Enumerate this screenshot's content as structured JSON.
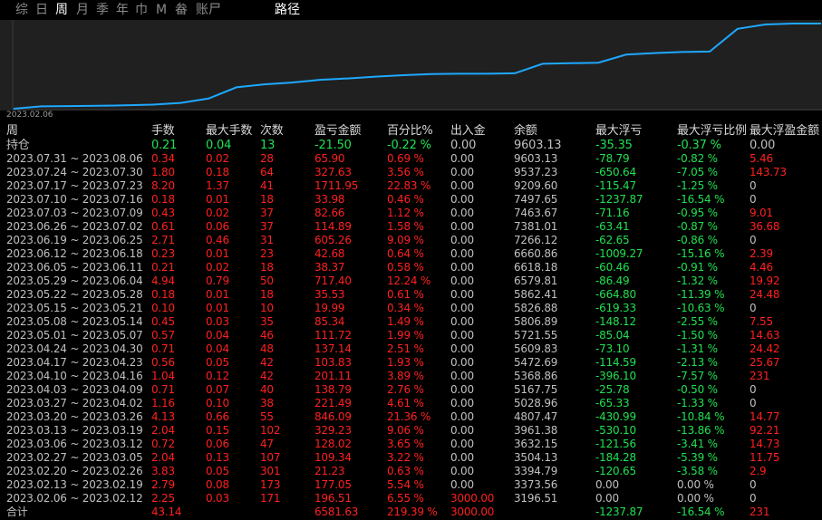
{
  "tabs": [
    {
      "label": "综",
      "active": false
    },
    {
      "label": "日",
      "active": false
    },
    {
      "label": "周",
      "active": true
    },
    {
      "label": "月",
      "active": false
    },
    {
      "label": "季",
      "active": false
    },
    {
      "label": "年",
      "active": false
    },
    {
      "label": "巾",
      "active": false
    },
    {
      "label": "M",
      "active": false
    },
    {
      "label": "畚",
      "active": false
    },
    {
      "label": "账尸",
      "active": false
    }
  ],
  "path_label": "路径",
  "chart_data": {
    "type": "line",
    "title": "",
    "x_tick_labels": [
      "2023.02.06"
    ],
    "series": [
      {
        "values": [
          3196.51,
          3373.56,
          3394.79,
          3413.0,
          3450.0,
          3504.13,
          3632.15,
          3961.38,
          4807.47,
          5028.96,
          5167.75,
          5368.86,
          5472.69,
          5609.83,
          5721.55,
          5806.89,
          5826.88,
          5826.88,
          5862.41,
          6579.81,
          6618.18,
          6660.86,
          7266.12,
          7381.01,
          7463.67,
          7497.65,
          9209.6,
          9537.23,
          9603.13,
          9603.13
        ]
      }
    ],
    "grid": false,
    "line_color": "#1ea8ff"
  },
  "table": {
    "period_header": "周",
    "headers": [
      "手数",
      "最大手数",
      "次数",
      "盈亏金额",
      "百分比%",
      "出入金",
      "余额",
      "最大浮亏",
      "最大浮亏比例",
      "最大浮盈金额"
    ],
    "holding": {
      "label": "持仓",
      "values": [
        "0.21",
        "0.04",
        "13",
        "-21.50",
        "-0.22 %",
        "0.00",
        "9603.13",
        "-35.35",
        "-0.37 %",
        "0.00"
      ]
    },
    "rows": [
      {
        "period": "2023.07.31 ~ 2023.08.06",
        "values": [
          "0.34",
          "0.02",
          "28",
          "65.90",
          "0.69 %",
          "0.00",
          "9603.13",
          "-78.79",
          "-0.82 %",
          "5.46"
        ]
      },
      {
        "period": "2023.07.24 ~ 2023.07.30",
        "values": [
          "1.80",
          "0.18",
          "64",
          "327.63",
          "3.56 %",
          "0.00",
          "9537.23",
          "-650.64",
          "-7.05 %",
          "143.73"
        ]
      },
      {
        "period": "2023.07.17 ~ 2023.07.23",
        "values": [
          "8.20",
          "1.37",
          "41",
          "1711.95",
          "22.83 %",
          "0.00",
          "9209.60",
          "-115.47",
          "-1.25 %",
          "0"
        ]
      },
      {
        "period": "2023.07.10 ~ 2023.07.16",
        "values": [
          "0.18",
          "0.01",
          "18",
          "33.98",
          "0.46 %",
          "0.00",
          "7497.65",
          "-1237.87",
          "-16.54 %",
          "0"
        ]
      },
      {
        "period": "2023.07.03 ~ 2023.07.09",
        "values": [
          "0.43",
          "0.02",
          "37",
          "82.66",
          "1.12 %",
          "0.00",
          "7463.67",
          "-71.16",
          "-0.95 %",
          "9.01"
        ]
      },
      {
        "period": "2023.06.26 ~ 2023.07.02",
        "values": [
          "0.61",
          "0.06",
          "37",
          "114.89",
          "1.58 %",
          "0.00",
          "7381.01",
          "-63.41",
          "-0.87 %",
          "36.68"
        ]
      },
      {
        "period": "2023.06.19 ~ 2023.06.25",
        "values": [
          "2.71",
          "0.46",
          "31",
          "605.26",
          "9.09 %",
          "0.00",
          "7266.12",
          "-62.65",
          "-0.86 %",
          "0"
        ]
      },
      {
        "period": "2023.06.12 ~ 2023.06.18",
        "values": [
          "0.23",
          "0.01",
          "23",
          "42.68",
          "0.64 %",
          "0.00",
          "6660.86",
          "-1009.27",
          "-15.16 %",
          "2.39"
        ]
      },
      {
        "period": "2023.06.05 ~ 2023.06.11",
        "values": [
          "0.21",
          "0.02",
          "18",
          "38.37",
          "0.58 %",
          "0.00",
          "6618.18",
          "-60.46",
          "-0.91 %",
          "4.46"
        ]
      },
      {
        "period": "2023.05.29 ~ 2023.06.04",
        "values": [
          "4.94",
          "0.79",
          "50",
          "717.40",
          "12.24 %",
          "0.00",
          "6579.81",
          "-86.49",
          "-1.32 %",
          "19.92"
        ]
      },
      {
        "period": "2023.05.22 ~ 2023.05.28",
        "values": [
          "0.18",
          "0.01",
          "18",
          "35.53",
          "0.61 %",
          "0.00",
          "5862.41",
          "-664.80",
          "-11.39 %",
          "24.48"
        ]
      },
      {
        "period": "2023.05.15 ~ 2023.05.21",
        "values": [
          "0.10",
          "0.01",
          "10",
          "19.99",
          "0.34 %",
          "0.00",
          "5826.88",
          "-619.33",
          "-10.63 %",
          "0"
        ]
      },
      {
        "period": "2023.05.08 ~ 2023.05.14",
        "values": [
          "0.45",
          "0.03",
          "35",
          "85.34",
          "1.49 %",
          "0.00",
          "5806.89",
          "-148.12",
          "-2.55 %",
          "7.55"
        ]
      },
      {
        "period": "2023.05.01 ~ 2023.05.07",
        "values": [
          "0.57",
          "0.04",
          "46",
          "111.72",
          "1.99 %",
          "0.00",
          "5721.55",
          "-85.04",
          "-1.50 %",
          "14.63"
        ]
      },
      {
        "period": "2023.04.24 ~ 2023.04.30",
        "values": [
          "0.71",
          "0.04",
          "48",
          "137.14",
          "2.51 %",
          "0.00",
          "5609.83",
          "-73.10",
          "-1.31 %",
          "24.42"
        ]
      },
      {
        "period": "2023.04.17 ~ 2023.04.23",
        "values": [
          "0.56",
          "0.05",
          "42",
          "103.83",
          "1.93 %",
          "0.00",
          "5472.69",
          "-114.59",
          "-2.13 %",
          "25.67"
        ]
      },
      {
        "period": "2023.04.10 ~ 2023.04.16",
        "values": [
          "1.04",
          "0.12",
          "42",
          "201.11",
          "3.89 %",
          "0.00",
          "5368.86",
          "-396.10",
          "-7.57 %",
          "231"
        ]
      },
      {
        "period": "2023.04.03 ~ 2023.04.09",
        "values": [
          "0.71",
          "0.07",
          "40",
          "138.79",
          "2.76 %",
          "0.00",
          "5167.75",
          "-25.78",
          "-0.50 %",
          "0"
        ]
      },
      {
        "period": "2023.03.27 ~ 2023.04.02",
        "values": [
          "1.16",
          "0.10",
          "38",
          "221.49",
          "4.61 %",
          "0.00",
          "5028.96",
          "-65.33",
          "-1.33 %",
          "0"
        ]
      },
      {
        "period": "2023.03.20 ~ 2023.03.26",
        "values": [
          "4.13",
          "0.66",
          "55",
          "846.09",
          "21.36 %",
          "0.00",
          "4807.47",
          "-430.99",
          "-10.84 %",
          "14.77"
        ]
      },
      {
        "period": "2023.03.13 ~ 2023.03.19",
        "values": [
          "2.04",
          "0.15",
          "102",
          "329.23",
          "9.06 %",
          "0.00",
          "3961.38",
          "-530.10",
          "-13.86 %",
          "92.21"
        ]
      },
      {
        "period": "2023.03.06 ~ 2023.03.12",
        "values": [
          "0.72",
          "0.06",
          "47",
          "128.02",
          "3.65 %",
          "0.00",
          "3632.15",
          "-121.56",
          "-3.41 %",
          "14.73"
        ]
      },
      {
        "period": "2023.02.27 ~ 2023.03.05",
        "values": [
          "2.04",
          "0.13",
          "107",
          "109.34",
          "3.22 %",
          "0.00",
          "3504.13",
          "-184.28",
          "-5.39 %",
          "11.75"
        ]
      },
      {
        "period": "2023.02.20 ~ 2023.02.26",
        "values": [
          "3.83",
          "0.05",
          "301",
          "21.23",
          "0.63 %",
          "0.00",
          "3394.79",
          "-120.65",
          "-3.58 %",
          "2.9"
        ]
      },
      {
        "period": "2023.02.13 ~ 2023.02.19",
        "values": [
          "2.79",
          "0.08",
          "173",
          "177.05",
          "5.54 %",
          "0.00",
          "3373.56",
          "0.00",
          "0.00 %",
          "0"
        ]
      },
      {
        "period": "2023.02.06 ~ 2023.02.12",
        "values": [
          "2.25",
          "0.03",
          "171",
          "196.51",
          "6.55 %",
          "3000.00",
          "3196.51",
          "0.00",
          "0.00 %",
          "0"
        ]
      }
    ],
    "total": {
      "label": "合计",
      "values": [
        "43.14",
        "",
        "",
        "6581.63",
        "219.39 %",
        "3000.00",
        "",
        "-1237.87",
        "-16.54 %",
        "231"
      ]
    }
  },
  "colors": {
    "profit": "#ff2020",
    "holding": "#20e050",
    "loss": "#20e050",
    "neutral": "#c0c0c0",
    "line": "#1ea8ff",
    "chart_bg": "#202020"
  }
}
